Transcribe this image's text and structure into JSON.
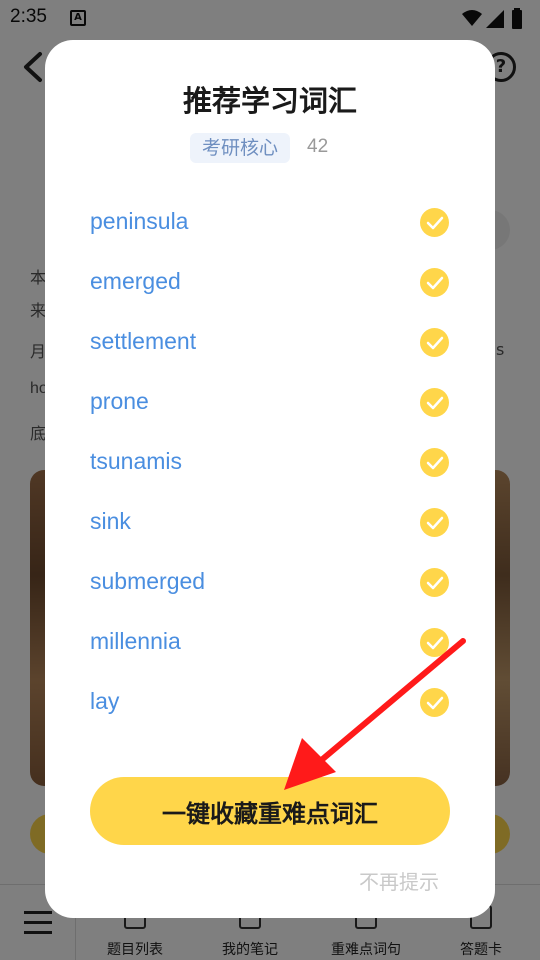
{
  "status_bar": {
    "time": "2:35",
    "a_badge": "A"
  },
  "background": {
    "help_icon": "question-circle-icon",
    "text_lines": [
      "本",
      "来",
      "月",
      "ho",
      "底"
    ],
    "right_text": "s",
    "bottom_nav": {
      "items": [
        {
          "label": "题目列表",
          "icon": "list-icon"
        },
        {
          "label": "我的笔记",
          "icon": "note-icon"
        },
        {
          "label": "重难点词句",
          "icon": "keypoint-icon"
        },
        {
          "label": "答题卡",
          "icon": "answer-card-icon"
        }
      ]
    }
  },
  "modal": {
    "title": "推荐学习词汇",
    "tag": "考研核心",
    "count": "42",
    "words": [
      {
        "text": "peninsula",
        "checked": true
      },
      {
        "text": "emerged",
        "checked": true
      },
      {
        "text": "settlement",
        "checked": true
      },
      {
        "text": "prone",
        "checked": true
      },
      {
        "text": "tsunamis",
        "checked": true
      },
      {
        "text": "sink",
        "checked": true
      },
      {
        "text": "submerged",
        "checked": true
      },
      {
        "text": "millennia",
        "checked": true
      },
      {
        "text": "lay",
        "checked": true
      }
    ],
    "collect_button": "一键收藏重难点词汇",
    "no_remind": "不再提示"
  },
  "colors": {
    "accent_yellow": "#ffd64a",
    "word_blue": "#4a8ee0",
    "annotation_red": "#ff1a1a"
  }
}
